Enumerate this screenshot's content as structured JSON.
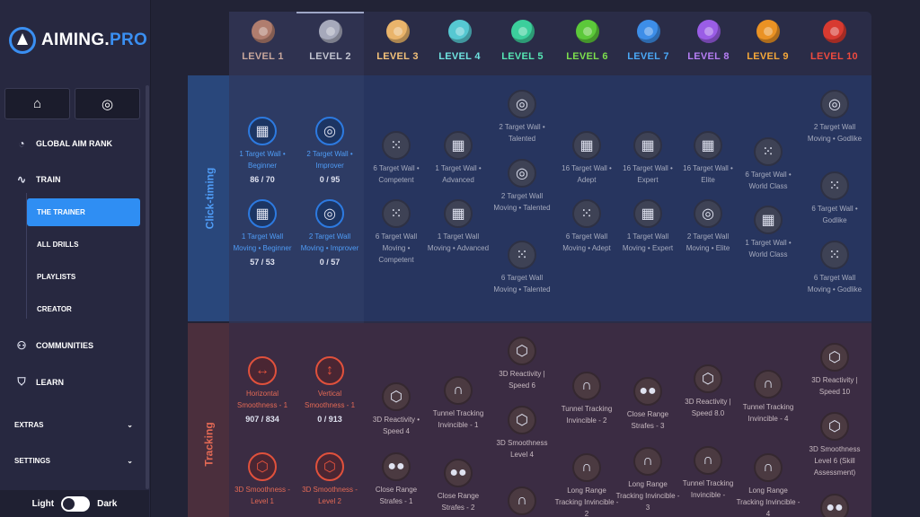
{
  "brand": {
    "name_main": "AIMING.",
    "name_accent": "PRO",
    "accent": "#3a8ff2"
  },
  "quick_buttons": [
    {
      "icon": "home-icon",
      "glyph": "⌂"
    },
    {
      "icon": "target-icon",
      "glyph": "◎"
    }
  ],
  "nav": {
    "global_aim_rank": "GLOBAL AIM RANK",
    "train": "TRAIN",
    "train_sub": {
      "the_trainer": "THE TRAINER",
      "all_drills": "ALL DRILLS",
      "playlists": "PLAYLISTS",
      "creator": "CREATOR"
    },
    "communities": "COMMUNITIES",
    "learn": "LEARN",
    "extras": "EXTRAS",
    "settings": "SETTINGS"
  },
  "theme": {
    "light": "Light",
    "dark": "Dark"
  },
  "levels": [
    {
      "label": "LEVEL 1",
      "color": "#c8a79c",
      "gem": "#b07d6e"
    },
    {
      "label": "LEVEL 2",
      "color": "#c1c3cf",
      "gem": "#a6a9bb"
    },
    {
      "label": "LEVEL 3",
      "color": "#f5c37a",
      "gem": "#e9b46b"
    },
    {
      "label": "LEVEL 4",
      "color": "#6fe3e0",
      "gem": "#56c8d2"
    },
    {
      "label": "LEVEL 5",
      "color": "#56e6b4",
      "gem": "#3ccf9c"
    },
    {
      "label": "LEVEL 6",
      "color": "#7cdf4d",
      "gem": "#5cc93a"
    },
    {
      "label": "LEVEL 7",
      "color": "#4aa8f7",
      "gem": "#3d8ee8"
    },
    {
      "label": "LEVEL 8",
      "color": "#b67ef5",
      "gem": "#9a5de6"
    },
    {
      "label": "LEVEL 9",
      "color": "#f6a839",
      "gem": "#ea9224"
    },
    {
      "label": "LEVEL 10",
      "color": "#f04a3e",
      "gem": "#d83a30"
    }
  ],
  "categories": {
    "click_timing": "Click-timing",
    "tracking": "Tracking",
    "click_color": "#4f9cf6",
    "tracking_color": "#e46a55"
  },
  "drills": {
    "c1a": {
      "name": "1 Target Wall • Beginner",
      "score": "86 / 70"
    },
    "c1b": {
      "name": "1 Target Wall Moving • Beginner",
      "score": "57 / 53"
    },
    "c2a": {
      "name": "2 Target Wall • Improver",
      "score": "0 / 95"
    },
    "c2b": {
      "name": "2 Target Wall Moving • Improver",
      "score": "0 / 57"
    },
    "c3a": {
      "name": "6 Target Wall • Competent"
    },
    "c3b": {
      "name": "6 Target Wall Moving • Competent"
    },
    "c4a": {
      "name": "1 Target Wall • Advanced"
    },
    "c4b": {
      "name": "1 Target Wall Moving • Advanced"
    },
    "c5a": {
      "name": "2 Target Wall • Talented"
    },
    "c5b": {
      "name": "2 Target Wall Moving • Talented"
    },
    "c5c": {
      "name": "6 Target Wall Moving • Talented"
    },
    "c6a": {
      "name": "16 Target Wall • Adept"
    },
    "c6b": {
      "name": "6 Target Wall Moving • Adept"
    },
    "c7a": {
      "name": "16 Target Wall • Expert"
    },
    "c7b": {
      "name": "1 Target Wall Moving • Expert"
    },
    "c8a": {
      "name": "16 Target Wall • Elite"
    },
    "c8b": {
      "name": "2 Target Wall Moving • Elite"
    },
    "c9a": {
      "name": "6 Target Wall • World Class"
    },
    "c9b": {
      "name": "1 Target Wall • World Class"
    },
    "c10a": {
      "name": "2 Target Wall Moving • Godlike"
    },
    "c10b": {
      "name": "6 Target Wall • Godlike"
    },
    "c10c": {
      "name": "6 Target Wall Moving • Godlike"
    },
    "t1a": {
      "name": "Horizontal Smoothness - 1",
      "score": "907 / 834"
    },
    "t1b": {
      "name": "3D Smoothness - Level 1"
    },
    "t2a": {
      "name": "Vertical Smoothness - 1",
      "score": "0 / 913"
    },
    "t2b": {
      "name": "3D Smoothness - Level 2"
    },
    "t3a": {
      "name": "3D Reactivity • Speed 4"
    },
    "t3b": {
      "name": "Close Range Strafes - 1"
    },
    "t4a": {
      "name": "Tunnel Tracking Invincible - 1"
    },
    "t4b": {
      "name": "Close Range Strafes - 2"
    },
    "t5a": {
      "name": "3D Reactivity | Speed 6"
    },
    "t5b": {
      "name": "3D Smoothness Level 4"
    },
    "t6a": {
      "name": "Tunnel Tracking Invincible - 2"
    },
    "t6b": {
      "name": "Long Range Tracking Invincible - 2"
    },
    "t7a": {
      "name": "Close Range Strafes - 3"
    },
    "t7b": {
      "name": "Long Range Tracking Invincible - 3"
    },
    "t8a": {
      "name": "3D Reactivity | Speed 8.0"
    },
    "t8b": {
      "name": "Tunnel Tracking Invincible -"
    },
    "t9a": {
      "name": "Tunnel Tracking Invincible - 4"
    },
    "t9b": {
      "name": "Long Range Tracking Invincible - 4"
    },
    "t10a": {
      "name": "3D Reactivity | Speed 10"
    },
    "t10b": {
      "name": "3D Smoothness Level 6 (Skill Assessment)"
    }
  }
}
